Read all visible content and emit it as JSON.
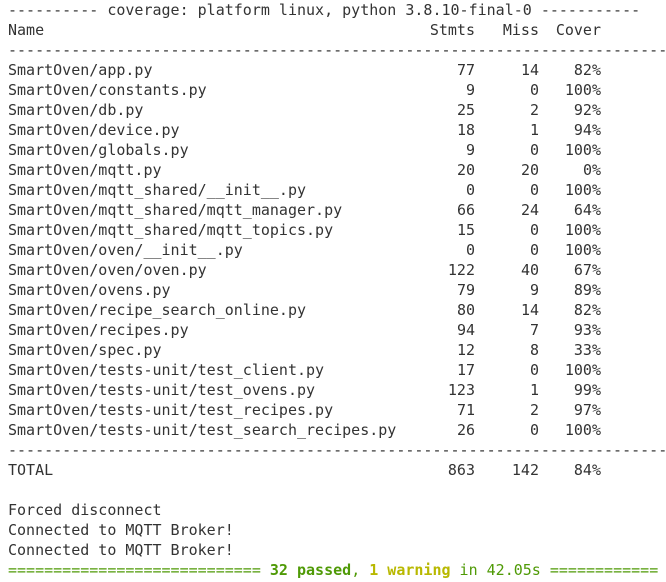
{
  "header_rule": "---------- coverage: platform linux, python 3.8.10-final-0 -----------",
  "columns": {
    "name": "Name",
    "stmts": "Stmts",
    "miss": "Miss",
    "cover": "Cover"
  },
  "separator": "-------------------------------------------------------------------------",
  "rows": [
    {
      "name": "SmartOven/app.py",
      "stmts": "77",
      "miss": "14",
      "cover": "82%"
    },
    {
      "name": "SmartOven/constants.py",
      "stmts": "9",
      "miss": "0",
      "cover": "100%"
    },
    {
      "name": "SmartOven/db.py",
      "stmts": "25",
      "miss": "2",
      "cover": "92%"
    },
    {
      "name": "SmartOven/device.py",
      "stmts": "18",
      "miss": "1",
      "cover": "94%"
    },
    {
      "name": "SmartOven/globals.py",
      "stmts": "9",
      "miss": "0",
      "cover": "100%"
    },
    {
      "name": "SmartOven/mqtt.py",
      "stmts": "20",
      "miss": "20",
      "cover": "0%"
    },
    {
      "name": "SmartOven/mqtt_shared/__init__.py",
      "stmts": "0",
      "miss": "0",
      "cover": "100%"
    },
    {
      "name": "SmartOven/mqtt_shared/mqtt_manager.py",
      "stmts": "66",
      "miss": "24",
      "cover": "64%"
    },
    {
      "name": "SmartOven/mqtt_shared/mqtt_topics.py",
      "stmts": "15",
      "miss": "0",
      "cover": "100%"
    },
    {
      "name": "SmartOven/oven/__init__.py",
      "stmts": "0",
      "miss": "0",
      "cover": "100%"
    },
    {
      "name": "SmartOven/oven/oven.py",
      "stmts": "122",
      "miss": "40",
      "cover": "67%"
    },
    {
      "name": "SmartOven/ovens.py",
      "stmts": "79",
      "miss": "9",
      "cover": "89%"
    },
    {
      "name": "SmartOven/recipe_search_online.py",
      "stmts": "80",
      "miss": "14",
      "cover": "82%"
    },
    {
      "name": "SmartOven/recipes.py",
      "stmts": "94",
      "miss": "7",
      "cover": "93%"
    },
    {
      "name": "SmartOven/spec.py",
      "stmts": "12",
      "miss": "8",
      "cover": "33%"
    },
    {
      "name": "SmartOven/tests-unit/test_client.py",
      "stmts": "17",
      "miss": "0",
      "cover": "100%"
    },
    {
      "name": "SmartOven/tests-unit/test_ovens.py",
      "stmts": "123",
      "miss": "1",
      "cover": "99%"
    },
    {
      "name": "SmartOven/tests-unit/test_recipes.py",
      "stmts": "71",
      "miss": "2",
      "cover": "97%"
    },
    {
      "name": "SmartOven/tests-unit/test_search_recipes.py",
      "stmts": "26",
      "miss": "0",
      "cover": "100%"
    }
  ],
  "total": {
    "name": "TOTAL",
    "stmts": "863",
    "miss": "142",
    "cover": "84%"
  },
  "messages": [
    "Forced disconnect",
    "Connected to MQTT Broker!",
    "Connected to MQTT Broker!"
  ],
  "summary": {
    "left_rule": "============================ ",
    "passed": "32 passed",
    "comma": ", ",
    "warning": "1 warning",
    "time": " in 42.05s",
    "right_rule": " ============"
  },
  "colors": {
    "text": "#333333",
    "passed": "#4f9a06",
    "warning": "#b8b800",
    "background": "#ffffff"
  }
}
